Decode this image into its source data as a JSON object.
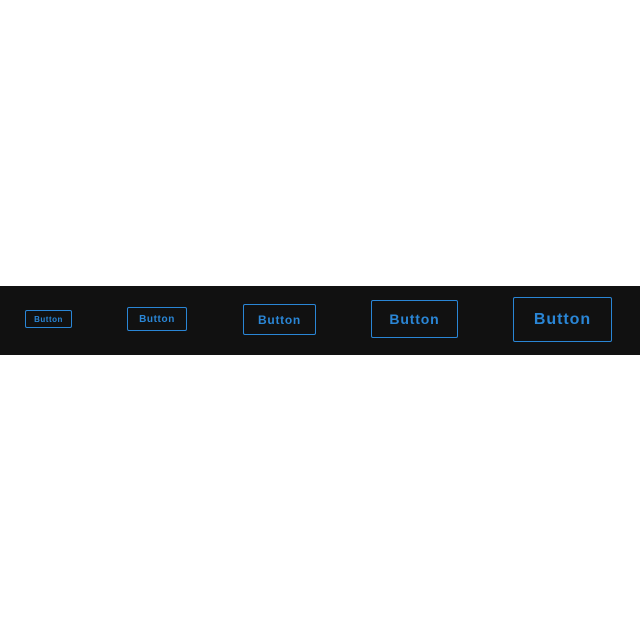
{
  "colors": {
    "strip_background": "#111111",
    "button_accent": "#2a86d6",
    "page_background": "#ffffff"
  },
  "buttons": [
    {
      "size": "extra-small",
      "label": "Button"
    },
    {
      "size": "small",
      "label": "Button"
    },
    {
      "size": "medium",
      "label": "Button"
    },
    {
      "size": "large",
      "label": "Button"
    },
    {
      "size": "extra-large",
      "label": "Button"
    }
  ]
}
